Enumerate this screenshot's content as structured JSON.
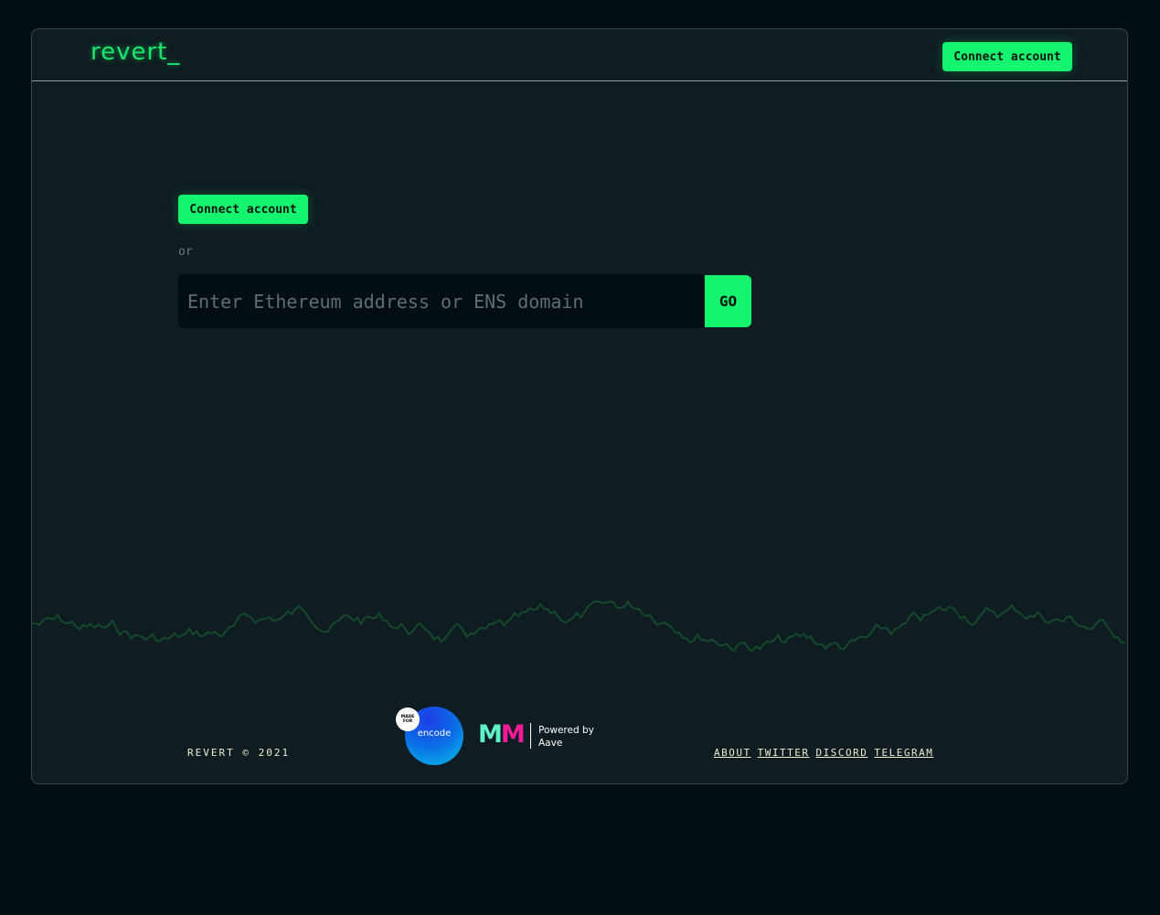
{
  "header": {
    "logo": "revert_",
    "connect_label": "Connect account"
  },
  "main": {
    "connect_label": "Connect account",
    "or_text": "or",
    "search_placeholder": "Enter Ethereum address or ENS domain",
    "search_value": "",
    "go_label": "GO"
  },
  "footer": {
    "copyright": "REVERT © 2021",
    "encode_badge": {
      "made_for": "MADE FOR",
      "name": "encode"
    },
    "mm_logo": "MM",
    "powered_line1": "Powered by",
    "powered_line2": "Aave",
    "links": [
      "ABOUT",
      "TWITTER",
      "DISCORD",
      "TELEGRAM"
    ]
  },
  "colors": {
    "accent": "#15f46f",
    "background": "#010f14",
    "panel": "#0f1c21",
    "wave": "#134a2b"
  }
}
